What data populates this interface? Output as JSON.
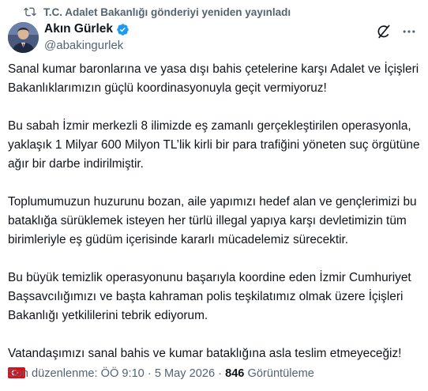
{
  "repost": {
    "label": "T.C. Adalet Bakanlığı gönderiyi yeniden yayınladı",
    "icon": "repost-icon"
  },
  "author": {
    "name": "Akın Gürlek",
    "handle": "@abakingurlek",
    "verified_icon": "verified-badge-icon",
    "verified_color": "#1d9bf0"
  },
  "actions": {
    "grok_icon": "grok-icon",
    "more_icon": "more-options-icon"
  },
  "tweet": {
    "paragraphs": [
      "Sanal kumar baronlarına ve yasa dışı bahis çetelerine karşı Adalet ve İçişleri Bakanlıklarımızın güçlü koordinasyonuyla geçit vermiyoruz!",
      "Bu sabah İzmir merkezli 8 ilimizde eş zamanlı gerçekleştirilen operasyonla, yaklaşık 1 Milyar 600 Milyon TL’lik kirli bir para trafiğini yöneten suç örgütüne ağır bir darbe indirilmiştir.",
      "Toplumumuzun huzurunu bozan, aile yapımızı hedef alan ve gençlerimizi bu bataklığa sürüklemek isteyen her türlü illegal yapıya karşı devletimizin tüm birimleriyle eş güdüm içerisinde kararlı mücadelemiz sürecektir.",
      "Bu büyük temizlik operasyonunu başarıyla koordine eden İzmir Cumhuriyet Başsavcılığımızı ve başta kahraman polis teşkilatımız olmak üzere İçişleri Bakanlığı yetkililerini tebrik ediyorum.",
      "Vatandaşımızı sanal bahis ve kumar bataklığına asla teslim etmeyeceğiz!"
    ],
    "emoji": "turkey-flag-emoji"
  },
  "meta": {
    "edited_label": "Son düzenlenme: ÖÖ 9:10",
    "separator": "·",
    "date": "5 May 2026",
    "views_count": "846",
    "views_label": "Görüntüleme"
  }
}
